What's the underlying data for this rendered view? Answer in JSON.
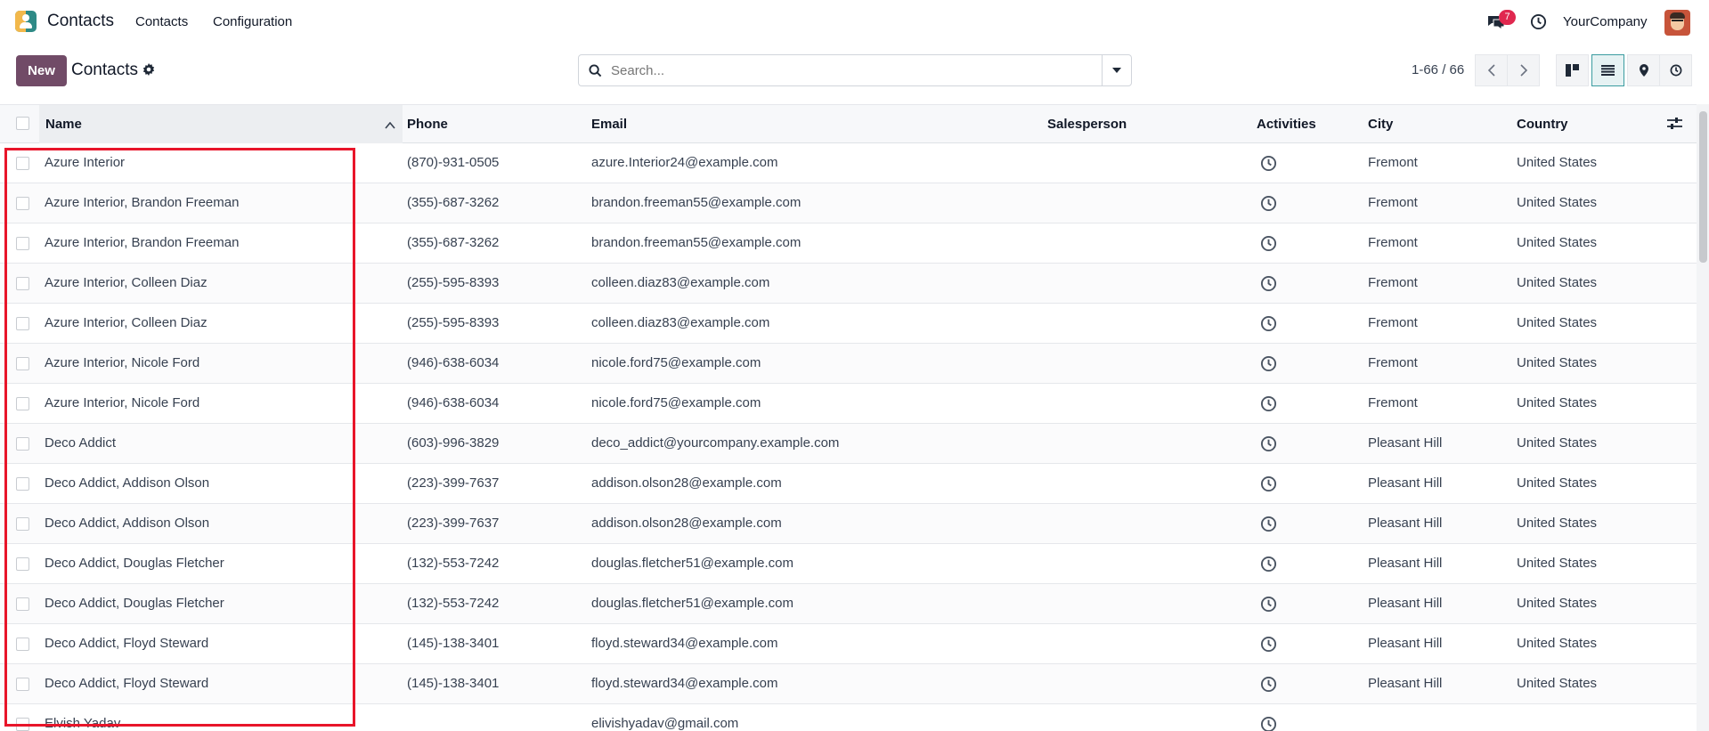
{
  "navbar": {
    "app_name": "Contacts",
    "menu": [
      "Contacts",
      "Configuration"
    ],
    "chat_badge": "7",
    "company": "YourCompany"
  },
  "control": {
    "new_label": "New",
    "breadcrumb": "Contacts",
    "search_placeholder": "Search...",
    "pager": "1-66 / 66"
  },
  "columns": {
    "name": "Name",
    "phone": "Phone",
    "email": "Email",
    "salesperson": "Salesperson",
    "activities": "Activities",
    "city": "City",
    "country": "Country"
  },
  "rows": [
    {
      "name": "Azure Interior",
      "phone": "(870)-931-0505",
      "email": "azure.Interior24@example.com",
      "salesperson": "",
      "city": "Fremont",
      "country": "United States"
    },
    {
      "name": "Azure Interior, Brandon Freeman",
      "phone": "(355)-687-3262",
      "email": "brandon.freeman55@example.com",
      "salesperson": "",
      "city": "Fremont",
      "country": "United States"
    },
    {
      "name": "Azure Interior, Brandon Freeman",
      "phone": "(355)-687-3262",
      "email": "brandon.freeman55@example.com",
      "salesperson": "",
      "city": "Fremont",
      "country": "United States"
    },
    {
      "name": "Azure Interior, Colleen Diaz",
      "phone": "(255)-595-8393",
      "email": "colleen.diaz83@example.com",
      "salesperson": "",
      "city": "Fremont",
      "country": "United States"
    },
    {
      "name": "Azure Interior, Colleen Diaz",
      "phone": "(255)-595-8393",
      "email": "colleen.diaz83@example.com",
      "salesperson": "",
      "city": "Fremont",
      "country": "United States"
    },
    {
      "name": "Azure Interior, Nicole Ford",
      "phone": "(946)-638-6034",
      "email": "nicole.ford75@example.com",
      "salesperson": "",
      "city": "Fremont",
      "country": "United States"
    },
    {
      "name": "Azure Interior, Nicole Ford",
      "phone": "(946)-638-6034",
      "email": "nicole.ford75@example.com",
      "salesperson": "",
      "city": "Fremont",
      "country": "United States"
    },
    {
      "name": "Deco Addict",
      "phone": "(603)-996-3829",
      "email": "deco_addict@yourcompany.example.com",
      "salesperson": "",
      "city": "Pleasant Hill",
      "country": "United States"
    },
    {
      "name": "Deco Addict, Addison Olson",
      "phone": "(223)-399-7637",
      "email": "addison.olson28@example.com",
      "salesperson": "",
      "city": "Pleasant Hill",
      "country": "United States"
    },
    {
      "name": "Deco Addict, Addison Olson",
      "phone": "(223)-399-7637",
      "email": "addison.olson28@example.com",
      "salesperson": "",
      "city": "Pleasant Hill",
      "country": "United States"
    },
    {
      "name": "Deco Addict, Douglas Fletcher",
      "phone": "(132)-553-7242",
      "email": "douglas.fletcher51@example.com",
      "salesperson": "",
      "city": "Pleasant Hill",
      "country": "United States"
    },
    {
      "name": "Deco Addict, Douglas Fletcher",
      "phone": "(132)-553-7242",
      "email": "douglas.fletcher51@example.com",
      "salesperson": "",
      "city": "Pleasant Hill",
      "country": "United States"
    },
    {
      "name": "Deco Addict, Floyd Steward",
      "phone": "(145)-138-3401",
      "email": "floyd.steward34@example.com",
      "salesperson": "",
      "city": "Pleasant Hill",
      "country": "United States"
    },
    {
      "name": "Deco Addict, Floyd Steward",
      "phone": "(145)-138-3401",
      "email": "floyd.steward34@example.com",
      "salesperson": "",
      "city": "Pleasant Hill",
      "country": "United States"
    },
    {
      "name": "Elvish Yadav",
      "phone": "",
      "email": "elivishyadav@gmail.com",
      "salesperson": "",
      "city": "",
      "country": ""
    }
  ],
  "colors": {
    "primary": "#714b67",
    "badge": "#e0284f",
    "highlight": "#e8152a",
    "active_view": "#3a9ca0"
  }
}
